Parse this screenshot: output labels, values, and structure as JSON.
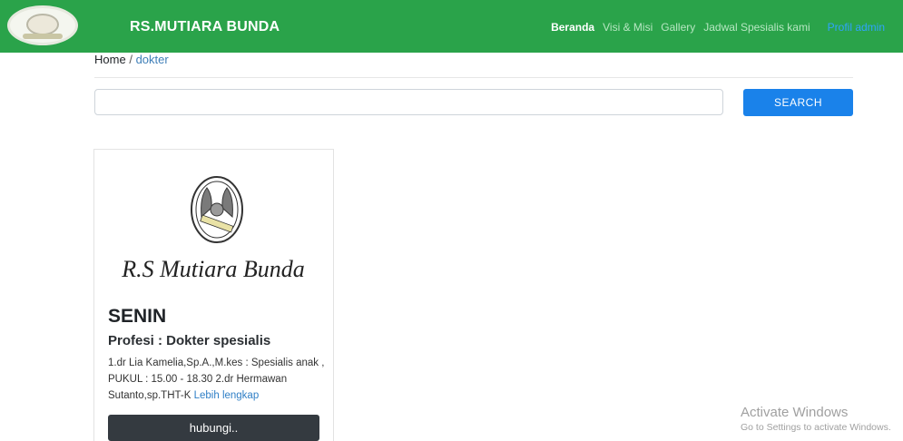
{
  "header": {
    "brand": "RS.MUTIARA BUNDA",
    "nav": [
      "Beranda",
      "Visi & Misi",
      "Gallery",
      "Jadwal Spesialis kami"
    ],
    "admin_link": "Profil admin",
    "colors": {
      "bar": "#2aa34a",
      "active": "#ffffff",
      "admin": "#2fa3ff"
    }
  },
  "breadcrumb": {
    "home": "Home",
    "separator": "/",
    "current": "dokter"
  },
  "search": {
    "value": "",
    "button": "SEARCH",
    "color": "#1a82ea"
  },
  "card": {
    "image_logo_text": "R.S Mutiara Bunda",
    "title": "SENIN",
    "subtitle": "Profesi : Dokter spesialis",
    "text": "1.dr Lia Kamelia,Sp.A.,M.kes : Spesialis anak , PUKUL : 15.00 - 18.30 2.dr Hermawan Sutanto,sp.THT-K",
    "more_link": "Lebih lengkap",
    "button": "hubungi.."
  },
  "watermark": {
    "line1": "Activate Windows",
    "line2": "Go to Settings to activate Windows."
  }
}
